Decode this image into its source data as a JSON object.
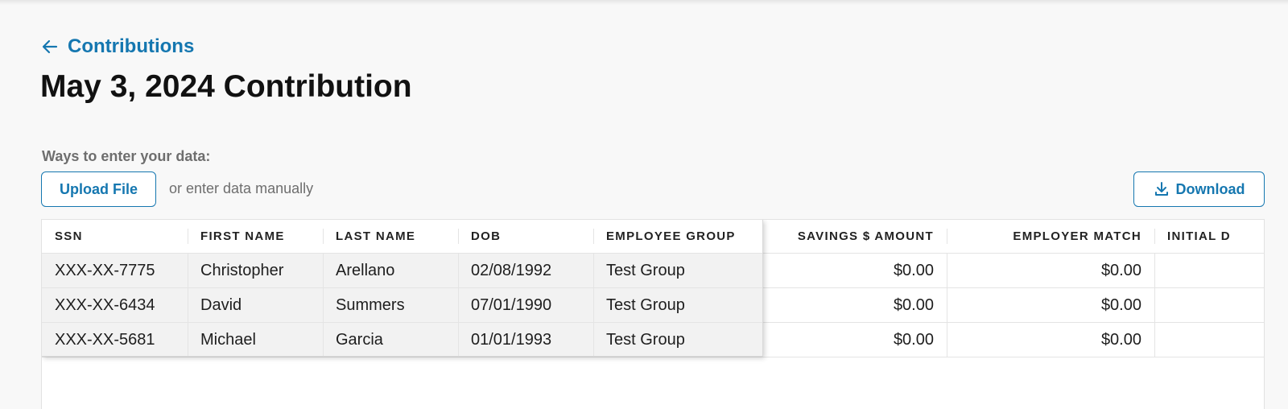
{
  "nav": {
    "back_label": "Contributions"
  },
  "page": {
    "title": "May 3, 2024 Contribution"
  },
  "data_entry": {
    "ways_label": "Ways to enter your data:",
    "upload_label": "Upload File",
    "manual_text": "or enter data manually",
    "download_label": "Download"
  },
  "table": {
    "headers": {
      "ssn": "SSN",
      "first_name": "FIRST NAME",
      "last_name": "LAST NAME",
      "dob": "DOB",
      "employee_group": "EMPLOYEE GROUP",
      "savings_amount": "SAVINGS $ AMOUNT",
      "employer_match": "EMPLOYER MATCH",
      "initial": "INITIAL D"
    },
    "rows": [
      {
        "ssn": "XXX-XX-7775",
        "first_name": "Christopher",
        "last_name": "Arellano",
        "dob": "02/08/1992",
        "employee_group": "Test Group",
        "savings_amount": "$0.00",
        "employer_match": "$0.00"
      },
      {
        "ssn": "XXX-XX-6434",
        "first_name": "David",
        "last_name": "Summers",
        "dob": "07/01/1990",
        "employee_group": "Test Group",
        "savings_amount": "$0.00",
        "employer_match": "$0.00"
      },
      {
        "ssn": "XXX-XX-5681",
        "first_name": "Michael",
        "last_name": "Garcia",
        "dob": "01/01/1993",
        "employee_group": "Test Group",
        "savings_amount": "$0.00",
        "employer_match": "$0.00"
      }
    ]
  },
  "colors": {
    "accent": "#1577b0",
    "muted_text": "#6e6e6e",
    "frozen_bg": "#f2f2f2"
  }
}
